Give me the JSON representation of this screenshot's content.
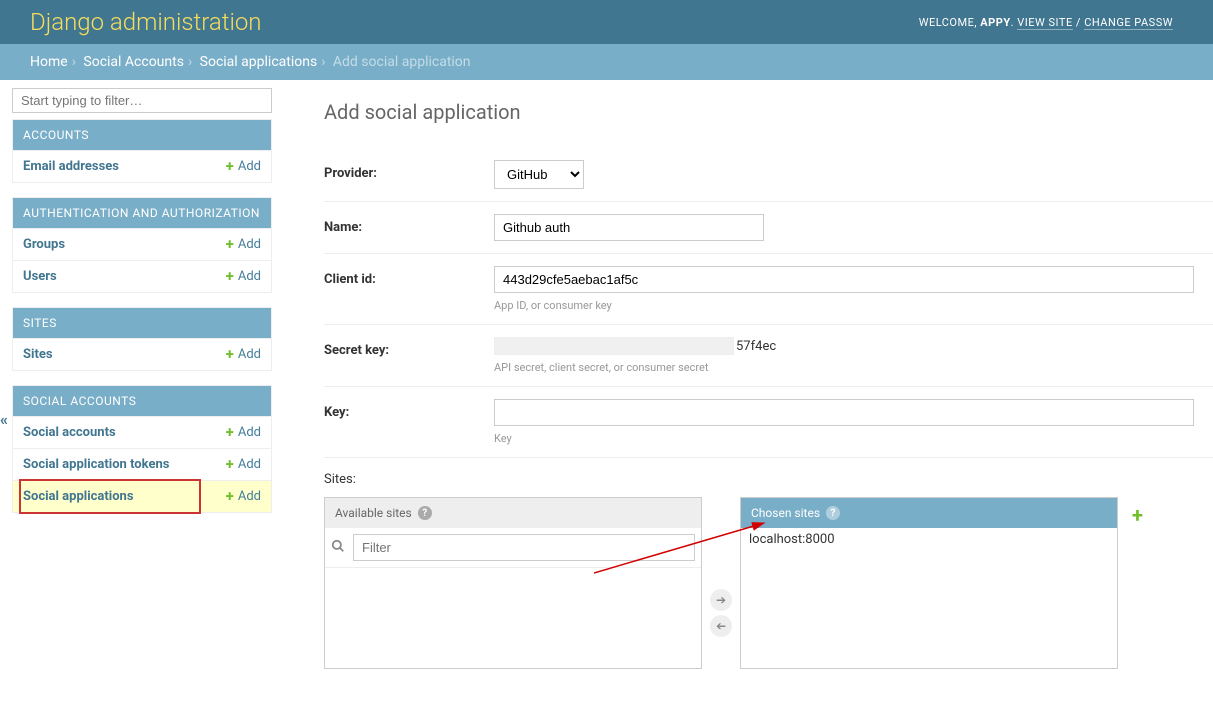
{
  "header": {
    "title": "Django administration",
    "welcome": "WELCOME, ",
    "user": "APPY",
    "view_site": "VIEW SITE",
    "change_password": "CHANGE PASSW"
  },
  "breadcrumbs": {
    "home": "Home",
    "social_accounts": "Social Accounts",
    "social_applications": "Social applications",
    "current": "Add social application"
  },
  "sidebar": {
    "filter_placeholder": "Start typing to filter…",
    "add_label": "Add",
    "sections": {
      "accounts": {
        "caption": "ACCOUNTS",
        "email_addresses": "Email addresses"
      },
      "auth": {
        "caption": "AUTHENTICATION AND AUTHORIZATION",
        "groups": "Groups",
        "users": "Users"
      },
      "sites": {
        "caption": "SITES",
        "sites": "Sites"
      },
      "social": {
        "caption": "SOCIAL ACCOUNTS",
        "accounts": "Social accounts",
        "tokens": "Social application tokens",
        "applications": "Social applications"
      }
    }
  },
  "page": {
    "title": "Add social application"
  },
  "form": {
    "provider_label": "Provider:",
    "provider_value": "GitHub",
    "name_label": "Name:",
    "name_value": "Github auth",
    "client_id_label": "Client id:",
    "client_id_value": "443d29cfe5aebac1af5c",
    "client_id_help": "App ID, or consumer key",
    "secret_label": "Secret key:",
    "secret_suffix": "57f4ec",
    "secret_help": "API secret, client secret, or consumer secret",
    "key_label": "Key:",
    "key_value": "",
    "key_help": "Key",
    "sites_label": "Sites:",
    "available_label": "Available sites",
    "chosen_label": "Chosen sites",
    "filter_placeholder": "Filter",
    "chosen_item": "localhost:8000"
  }
}
